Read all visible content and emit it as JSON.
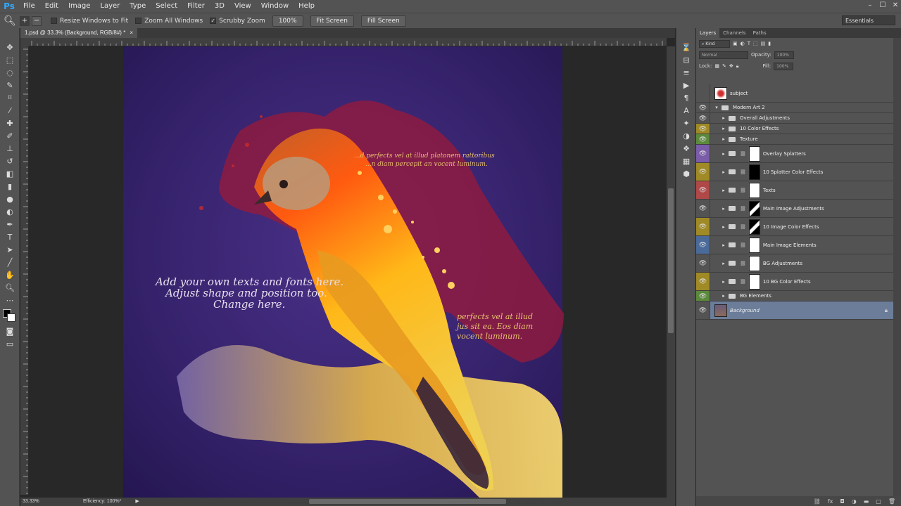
{
  "app": {
    "logo": "Ps"
  },
  "menu": [
    "File",
    "Edit",
    "Image",
    "Layer",
    "Type",
    "Select",
    "Filter",
    "3D",
    "View",
    "Window",
    "Help"
  ],
  "window_controls": [
    "–",
    "☐",
    "✕"
  ],
  "options": {
    "resize_windows": "Resize Windows to Fit",
    "zoom_all": "Zoom All Windows",
    "scrubby_zoom": "Scrubby Zoom",
    "zoom_value": "100%",
    "fit_screen": "Fit Screen",
    "fill_screen": "Fill Screen",
    "workspace": "Essentials"
  },
  "document": {
    "tab_title": "1.psd @ 33.3% (Background, RGB/8#) *",
    "tab_close": "×",
    "zoom": "33.33%",
    "efficiency": "Efficiency: 100%*"
  },
  "artwork": {
    "text_left_1": "Add your own texts and fonts here.",
    "text_left_2": "Adjust shape and position too.",
    "text_left_3": "Change here.",
    "text_top_1": "...d perfects vel at illud platonem rattoribus",
    "text_top_2": "...n diam percepit an vocent luminum.",
    "text_right_1": "perfects vel at illud",
    "text_right_2": "jus sit ea. Eos diam",
    "text_right_3": "vocent luminum."
  },
  "panel": {
    "tabs": [
      "Layers",
      "Channels",
      "Paths"
    ],
    "kind": "Kind",
    "blend_mode": "Normal",
    "opacity_label": "Opacity:",
    "opacity_value": "100%",
    "lock_label": "Lock:",
    "fill_label": "Fill:",
    "fill_value": "100%"
  },
  "layers": [
    {
      "name": "subject",
      "color": "#535353",
      "indent": 0,
      "folder": false,
      "tall": true,
      "eye": false
    },
    {
      "name": "Modern Art 2",
      "color": "#535353",
      "indent": 0,
      "folder": true,
      "open": true,
      "eye": true
    },
    {
      "name": "Overall Adjustments",
      "color": "#535353",
      "indent": 1,
      "folder": true,
      "eye": true
    },
    {
      "name": "10 Color Effects",
      "color": "#a08a26",
      "indent": 1,
      "folder": true,
      "eye": true
    },
    {
      "name": "Texture",
      "color": "#5c8a3c",
      "indent": 1,
      "folder": true,
      "eye": true
    },
    {
      "name": "Overlay Splatters",
      "color": "#7a5ca8",
      "indent": 1,
      "folder": true,
      "mask": "white",
      "eye": true
    },
    {
      "name": "10 Splatter Color Effects",
      "color": "#a08a26",
      "indent": 1,
      "folder": true,
      "mask": "black",
      "eye": true
    },
    {
      "name": "Texts",
      "color": "#b04848",
      "indent": 1,
      "folder": true,
      "mask": "white",
      "eye": true
    },
    {
      "name": "Main Image Adjustments",
      "color": "#535353",
      "indent": 1,
      "folder": true,
      "mask": "bird",
      "eye": true
    },
    {
      "name": "10 Image Color Effects",
      "color": "#a08a26",
      "indent": 1,
      "folder": true,
      "mask": "bird",
      "eye": true
    },
    {
      "name": "Main Image Elements",
      "color": "#4a6a9a",
      "indent": 1,
      "folder": true,
      "mask": "white",
      "eye": true
    },
    {
      "name": "BG Adjustments",
      "color": "#535353",
      "indent": 1,
      "folder": true,
      "mask": "white",
      "eye": true
    },
    {
      "name": "10 BG Color Effects",
      "color": "#a08a26",
      "indent": 1,
      "folder": true,
      "mask": "white",
      "eye": true
    },
    {
      "name": "BG Elements",
      "color": "#5c8a3c",
      "indent": 1,
      "folder": true,
      "eye": true
    },
    {
      "name": "Background",
      "color": "#535353",
      "indent": 0,
      "folder": false,
      "selected": true,
      "eye": true
    }
  ],
  "colors": {
    "accent": "#31a8ff",
    "selected_layer": "#6b7d99",
    "canvas_bg": "#3a2a70"
  }
}
